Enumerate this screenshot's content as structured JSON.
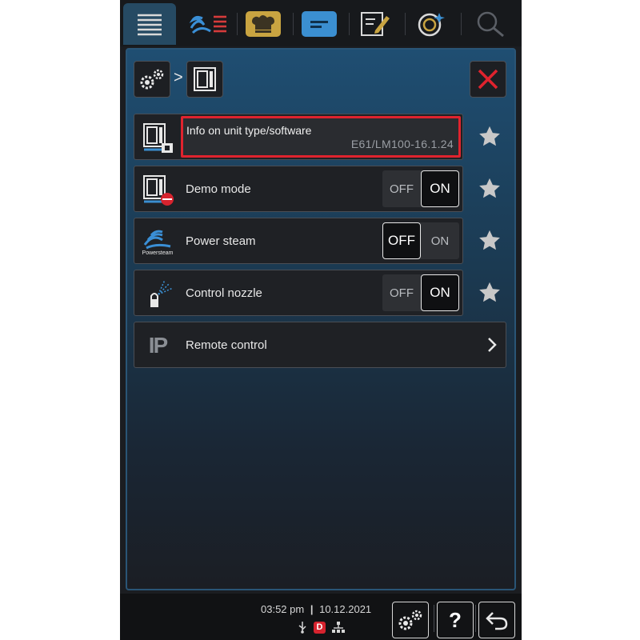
{
  "tabs": [
    {
      "name": "menu-lines-icon",
      "active": true
    },
    {
      "name": "intelligent-cooking-icon",
      "active": false
    },
    {
      "name": "chef-hat-icon",
      "active": false
    },
    {
      "name": "display-icon",
      "active": false
    },
    {
      "name": "edit-note-icon",
      "active": false
    },
    {
      "name": "efficiency-icon",
      "active": false
    },
    {
      "name": "search-icon",
      "active": false
    }
  ],
  "breadcrumb": {
    "separator": ">"
  },
  "rows": {
    "info": {
      "title": "Info on unit type/software",
      "value": "E61/LM100-16.1.24"
    },
    "demo": {
      "label": "Demo mode",
      "off": "OFF",
      "on": "ON",
      "selected": "ON"
    },
    "powersteam": {
      "label": "Power steam",
      "icon_caption": "Powersteam",
      "off": "OFF",
      "on": "ON",
      "selected": "OFF"
    },
    "nozzle": {
      "label": "Control nozzle",
      "off": "OFF",
      "on": "ON",
      "selected": "ON"
    },
    "remote": {
      "label": "Remote control",
      "icon_text": "IP"
    }
  },
  "status": {
    "time": "03:52 pm",
    "date": "10.12.2021",
    "divider": "|",
    "demo_badge": "D"
  },
  "bottom_buttons": {
    "help_label": "?"
  },
  "colors": {
    "highlight": "#e0232e",
    "accent": "#264a63"
  }
}
